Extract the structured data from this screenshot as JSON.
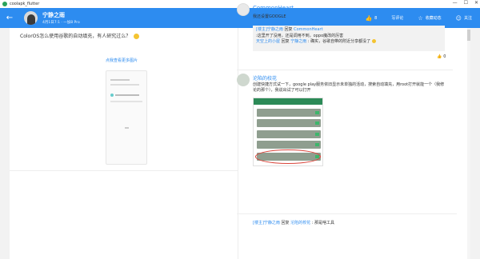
{
  "window": {
    "title": "coolapk_flutter",
    "controls": [
      "—",
      "☐",
      "✕"
    ]
  },
  "appbar": {
    "back_icon": "back-arrow-icon",
    "user_name": "宁静之雨",
    "user_sub": "4月1日7:1 · 一加8 Pro",
    "like_count": "8",
    "comment_label": "写评论",
    "favorite_label": "收藏动态",
    "follow_label": "关注"
  },
  "post": {
    "text": "ColorOS怎么使用谷歌的自动填充，有人研究过么？",
    "more_pics_label": "点我查看更多图片"
  },
  "comments": [
    {
      "author": "CommonHeart",
      "text": "我还设置GOOGLE",
      "replies": [
        {
          "author": "[楼主]宁静之雨",
          "verb": "回复",
          "target": "CommonHeart",
          "text": ":这里开了没用，还是调用不到，oppo魔改的厉害"
        },
        {
          "author": "天空上的小屋",
          "verb": "回复",
          "target": "宁静之雨",
          "text": ": 确实，谷歌自带的附近分享都没了"
        }
      ],
      "likes": "0"
    },
    {
      "author": "沦陷的校花",
      "text": "创建快捷方式试一下，google play服务依旧显示未单独的活动，搜索自动填充，用root打开就能一个（我修论的那个），我说出试了可以打开",
      "reply": {
        "author": "[楼主]宁静之雨",
        "verb": "回复",
        "target": "沦陷的校花",
        "text": ": 那是啥工具"
      }
    }
  ]
}
